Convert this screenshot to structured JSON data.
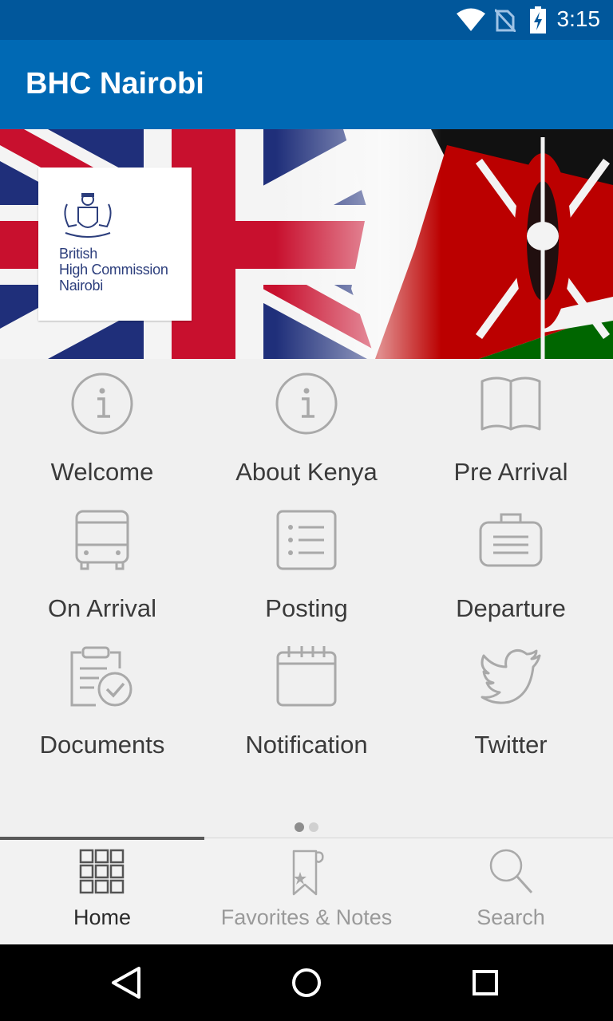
{
  "status_bar": {
    "time": "3:15",
    "icons": [
      "wifi-icon",
      "no-sim-icon",
      "battery-charging-icon"
    ]
  },
  "app_bar": {
    "title": "BHC Nairobi"
  },
  "banner": {
    "logo_lines": [
      "British",
      "High Commission",
      "Nairobi"
    ],
    "colors": {
      "uk_blue": "#1f2f7a",
      "uk_red": "#c8102e",
      "kenya_red": "#bb0000",
      "kenya_green": "#006600",
      "kenya_black": "#111111"
    }
  },
  "grid": {
    "items": [
      {
        "label": "Welcome",
        "icon": "info-icon"
      },
      {
        "label": "About Kenya",
        "icon": "info-icon"
      },
      {
        "label": "Pre Arrival",
        "icon": "book-icon"
      },
      {
        "label": "On Arrival",
        "icon": "bus-icon"
      },
      {
        "label": "Posting",
        "icon": "list-icon"
      },
      {
        "label": "Departure",
        "icon": "briefcase-icon"
      },
      {
        "label": "Documents",
        "icon": "clipboard-check-icon"
      },
      {
        "label": "Notification",
        "icon": "calendar-icon"
      },
      {
        "label": "Twitter",
        "icon": "twitter-icon"
      }
    ]
  },
  "pager": {
    "page_count": 2,
    "active_index": 0
  },
  "bottom_nav": {
    "active_index": 0,
    "items": [
      {
        "label": "Home",
        "icon": "grid-icon",
        "color": "#2b2b2b"
      },
      {
        "label": "Favorites & Notes",
        "icon": "bookmark-star-icon",
        "color": "#9a9a9a"
      },
      {
        "label": "Search",
        "icon": "search-icon",
        "color": "#9a9a9a"
      }
    ]
  },
  "system_nav": {
    "buttons": [
      "back-icon",
      "home-circle-icon",
      "recents-square-icon"
    ]
  },
  "colors": {
    "app_bar": "#0069b4",
    "status_bar": "#01579b",
    "icon_gray": "#a9a9a9",
    "label_text": "#3a3a3a"
  }
}
